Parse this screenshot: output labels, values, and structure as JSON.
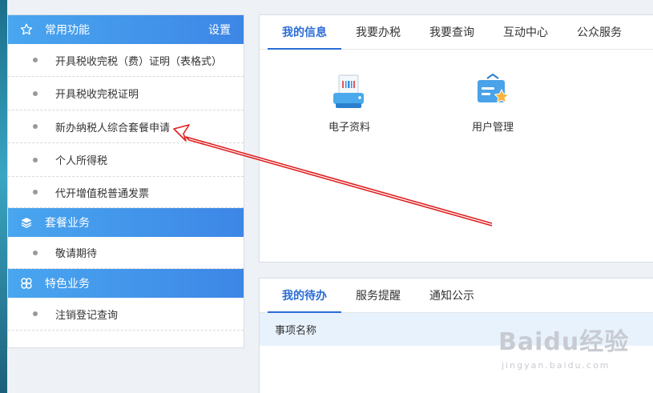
{
  "sidebar": {
    "sections": [
      {
        "title": "常用功能",
        "settings_label": "设置",
        "items": [
          "开具税收完税（费）证明（表格式）",
          "开具税收完税证明",
          "新办纳税人综合套餐申请",
          "个人所得税",
          "代开增值税普通发票"
        ]
      },
      {
        "title": "套餐业务",
        "items": [
          "敬请期待"
        ]
      },
      {
        "title": "特色业务",
        "items": [
          "注销登记查询"
        ]
      }
    ]
  },
  "top_panel": {
    "tabs": [
      "我的信息",
      "我要办税",
      "我要查询",
      "互动中心",
      "公众服务"
    ],
    "active_tab": 0,
    "apps": [
      {
        "label": "电子资料",
        "icon": "printer-icon"
      },
      {
        "label": "用户管理",
        "icon": "user-management-icon"
      }
    ]
  },
  "bottom_panel": {
    "tabs": [
      "我的待办",
      "服务提醒",
      "通知公示"
    ],
    "active_tab": 0,
    "table_header": "事项名称"
  },
  "watermark": {
    "logo": "Baidu经验",
    "url": "jingyan.baidu.com"
  },
  "colors": {
    "accent": "#2b6cd6",
    "header_gradient_start": "#49a6ef",
    "header_gradient_end": "#3d86e6",
    "annotation_arrow": "#e02020"
  }
}
